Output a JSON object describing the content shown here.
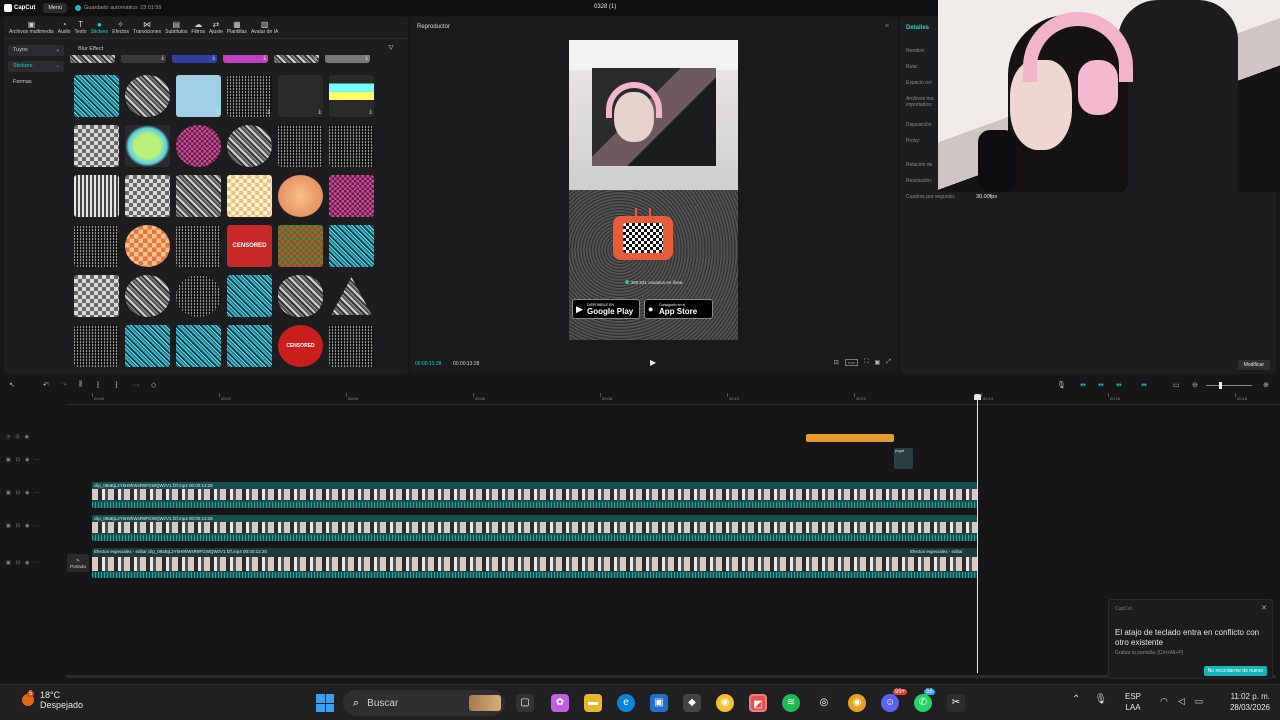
{
  "app": {
    "logo": "CapCut",
    "menu": "Menú",
    "autosave": "Guardado automático: 23:01:59",
    "project_title": "0328 (1)"
  },
  "toolbar": [
    {
      "label": "Archivos multimedia",
      "icon": "media-icon"
    },
    {
      "label": "Audio",
      "icon": "audio-icon"
    },
    {
      "label": "Texto",
      "icon": "text-icon"
    },
    {
      "label": "Stickers",
      "icon": "sticker-icon",
      "active": true
    },
    {
      "label": "Efectos",
      "icon": "effects-icon"
    },
    {
      "label": "Transiciones",
      "icon": "transitions-icon"
    },
    {
      "label": "Subtítulos",
      "icon": "captions-icon"
    },
    {
      "label": "Filtros",
      "icon": "filters-icon"
    },
    {
      "label": "Ajuste",
      "icon": "adjust-icon"
    },
    {
      "label": "Plantillas",
      "icon": "templates-icon"
    },
    {
      "label": "Avatar de IA",
      "icon": "ai-avatar-icon"
    }
  ],
  "categories": [
    "Tuyos",
    "Stickers",
    "Formas"
  ],
  "sticker_section": "Blur Effect",
  "player": {
    "title": "Reproductor",
    "time_current": "00:00:13:28",
    "time_total": "00:00:13:28",
    "overlay": {
      "online": "389.931 usuarios en línea",
      "google_play_top": "DISPONIBLE EN",
      "google_play": "Google Play",
      "app_store_top": "Consíguelo en el",
      "app_store": "App Store"
    }
  },
  "details": {
    "tab": "Detalles",
    "rows": [
      "Nombre:",
      "Ruta:",
      "Espacio oci",
      "Archivos mu importados:",
      "Disposición",
      "Proxy:",
      "Relación de",
      "Resolución:",
      "Cuadros por segundo:"
    ],
    "fps": "30.00fps",
    "modify": "Modificar"
  },
  "timeline": {
    "ticks": [
      "00:00",
      "00:02",
      "00:04",
      "00:06",
      "00:08",
      "00:10",
      "00:12",
      "00:14",
      "00:16",
      "00:18"
    ],
    "png_label": "pngwi",
    "clips": [
      {
        "label": "clip_09aBjL2YkH9hWsR9FGWQWzV1.f2f.mp4   00:00:13:28"
      },
      {
        "label": "clip_09aBjL2YkH9hWsR9FGWQWzV1.f2f.mp4   00:00:13:28"
      },
      {
        "label": "Efectos especiales - editar   clip_09aBjL2YkH9hWsR9FGWQWzV1.f2f.mp4   00:00:12:25"
      }
    ],
    "clip_tail_label": "Efectos especiales - editar",
    "cover": "Portada"
  },
  "toast": {
    "app": "CapCut",
    "title": "El atajo de teclado entra en conflicto con otro existente",
    "subtitle": "Grabar la pantalla: [Ctrl+Alt+P]",
    "button": "No recordarme de nuevo"
  },
  "taskbar": {
    "weather_badge": "5",
    "temp": "18°C",
    "condition": "Despejado",
    "search": "Buscar",
    "badges": [
      "55",
      "99+"
    ],
    "lang": [
      "ESP",
      "LAA"
    ],
    "time": "11:02 p. m.",
    "date": "28/03/2026"
  }
}
